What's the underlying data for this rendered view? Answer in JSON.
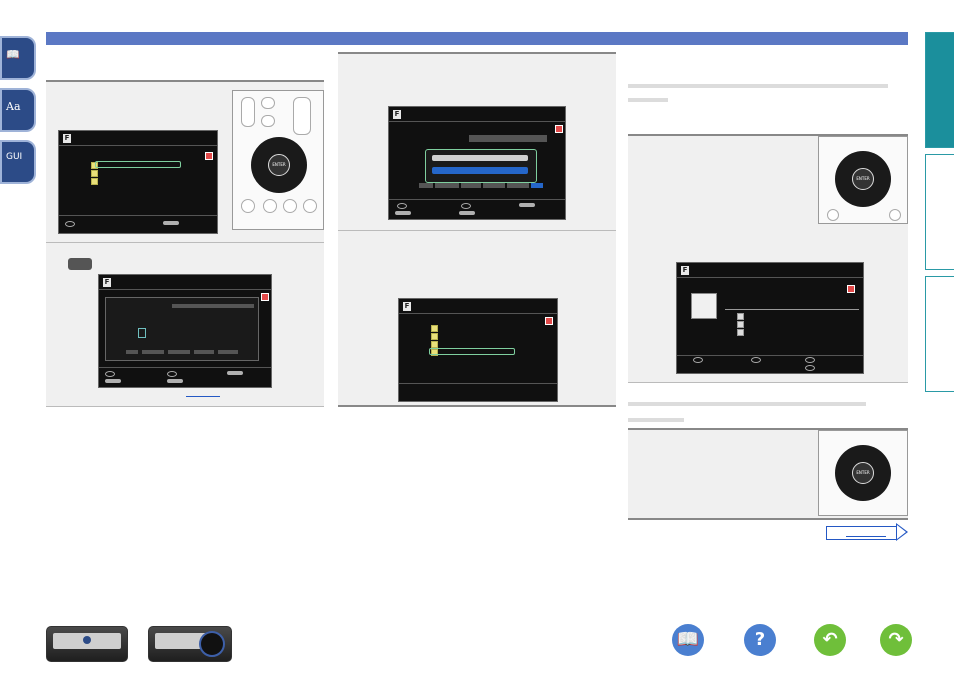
{
  "colors": {
    "accent": "#5b78c4",
    "teal": "#1b8f9c",
    "panel": "#f0f0f0",
    "screen": "#101010"
  },
  "left_icons": [
    {
      "name": "book-icon",
      "glyph": "📖"
    },
    {
      "name": "dictionary-icon",
      "glyph": "Aa"
    },
    {
      "name": "gui-icon",
      "glyph": "GUI"
    }
  ],
  "enter_label": "ENTER",
  "screen_logo": "F",
  "step_badge_label": "",
  "pager": {
    "next_link": ""
  },
  "bottom_nav": [
    {
      "name": "manual-icon",
      "glyph": "📖",
      "color": "#4a7fd0"
    },
    {
      "name": "help-icon",
      "glyph": "?",
      "color": "#4a7fd0"
    },
    {
      "name": "back-icon",
      "glyph": "↶",
      "color": "#6fbf3a"
    },
    {
      "name": "forward-icon",
      "glyph": "↷",
      "color": "#6fbf3a"
    }
  ]
}
